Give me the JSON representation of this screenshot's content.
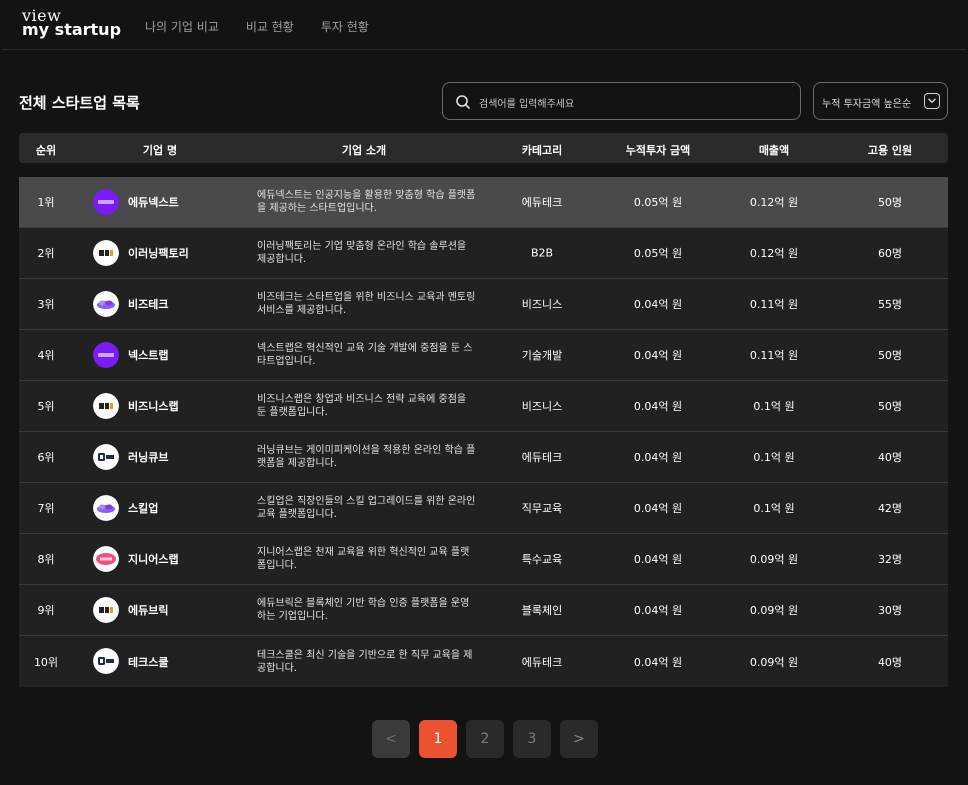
{
  "app": {
    "logo_top": "view",
    "logo_bottom": "my startup"
  },
  "nav": [
    "나의 기업 비교",
    "비교 현황",
    "투자 현황"
  ],
  "page": {
    "title": "전체 스타트업 목록"
  },
  "search": {
    "placeholder": "검색어를 입력해주세요"
  },
  "sort": {
    "selected": "누적 투자금액 높은순"
  },
  "table": {
    "columns": [
      "순위",
      "기업 명",
      "기업 소개",
      "카테고리",
      "누적투자 금액",
      "매출액",
      "고용 인원"
    ],
    "rows": [
      {
        "rank": "1위",
        "name": "에듀넥스트",
        "logo": "codeit",
        "desc": "에듀넥스트는 인공지능을 활용한 맞춤형 학습 플랫폼을 제공하는 스타트업입니다.",
        "category": "에듀테크",
        "investment": "0.05억 원",
        "revenue": "0.12억 원",
        "employees": "50명"
      },
      {
        "rank": "2위",
        "name": "이러닝팩토리",
        "logo": "bubble",
        "desc": "이러닝팩토리는 기업 맞춤형 온라인 학습 솔루션을 제공합니다.",
        "category": "B2B",
        "investment": "0.05억 원",
        "revenue": "0.12억 원",
        "employees": "60명"
      },
      {
        "rank": "3위",
        "name": "비즈테크",
        "logo": "purple",
        "desc": "비즈테크는 스타트업을 위한 비즈니스 교육과 멘토링 서비스를 제공합니다.",
        "category": "비즈니스",
        "investment": "0.04억 원",
        "revenue": "0.11억 원",
        "employees": "55명"
      },
      {
        "rank": "4위",
        "name": "넥스트랩",
        "logo": "codeit",
        "desc": "넥스트랩은 혁신적인 교육 기술 개발에 중점을 둔 스타트업입니다.",
        "category": "기술개발",
        "investment": "0.04억 원",
        "revenue": "0.11억 원",
        "employees": "50명"
      },
      {
        "rank": "5위",
        "name": "비즈니스랩",
        "logo": "bubble",
        "desc": "비즈니스랩은 창업과 비즈니스 전략 교육에 중점을 둔 플랫폼입니다.",
        "category": "비즈니스",
        "investment": "0.04억 원",
        "revenue": "0.1억 원",
        "employees": "50명"
      },
      {
        "rank": "6위",
        "name": "러닝큐브",
        "logo": "mkit",
        "desc": "러닝큐브는 게이미피케이션을 적용한 온라인 학습 플랫폼을 제공합니다.",
        "category": "에듀테크",
        "investment": "0.04억 원",
        "revenue": "0.1억 원",
        "employees": "40명"
      },
      {
        "rank": "7위",
        "name": "스킬업",
        "logo": "purple",
        "desc": "스킬업은 직장인들의 스킬 업그레이드를 위한 온라인 교육 플랫폼입니다.",
        "category": "직무교육",
        "investment": "0.04억 원",
        "revenue": "0.1억 원",
        "employees": "42명"
      },
      {
        "rank": "8위",
        "name": "지니어스랩",
        "logo": "pink",
        "desc": "지니어스랩은 천재 교육을 위한 혁신적인 교육 플랫폼입니다.",
        "category": "특수교육",
        "investment": "0.04억 원",
        "revenue": "0.09억 원",
        "employees": "32명"
      },
      {
        "rank": "9위",
        "name": "에듀브릭",
        "logo": "bubble",
        "desc": "에듀브릭은 블록체인 기반 학습 인증 플랫폼을 운영하는 기업입니다.",
        "category": "블록체인",
        "investment": "0.04억 원",
        "revenue": "0.09억 원",
        "employees": "30명"
      },
      {
        "rank": "10위",
        "name": "테크스쿨",
        "logo": "mkit",
        "desc": "테크스쿨은 최신 기술을 기반으로 한 직무 교육을 제공합니다.",
        "category": "에듀테크",
        "investment": "0.04억 원",
        "revenue": "0.09억 원",
        "employees": "40명"
      }
    ]
  },
  "pagination": {
    "prev": "<",
    "pages": [
      "1",
      "2",
      "3"
    ],
    "current": "1",
    "next": ">"
  },
  "colors": {
    "accent": "#eb5230",
    "background": "#131313",
    "row": "#212121",
    "row_highlight": "#4a4a4a"
  }
}
